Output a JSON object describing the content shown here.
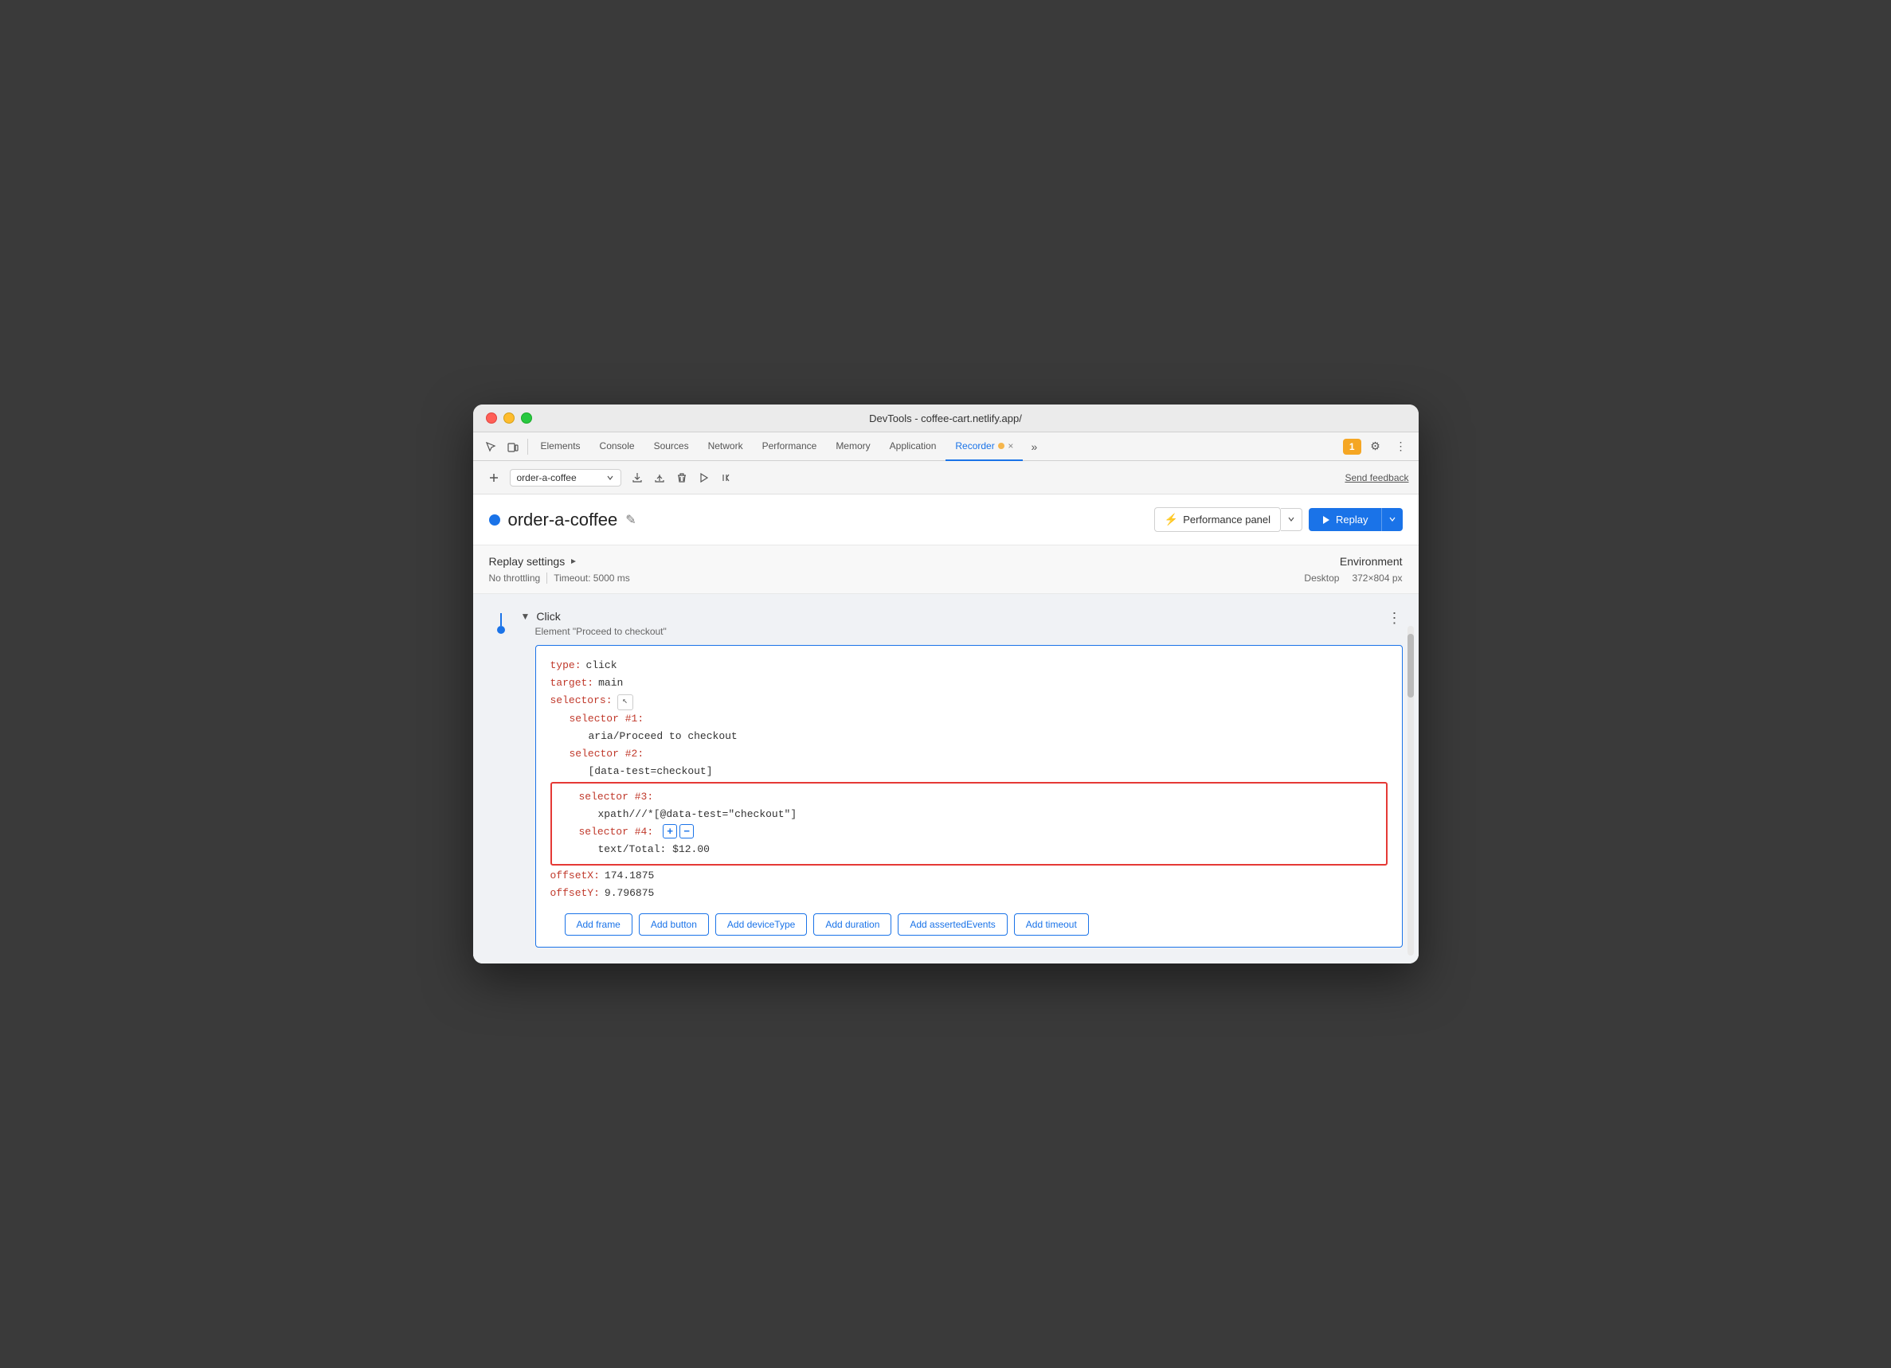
{
  "window": {
    "title": "DevTools - coffee-cart.netlify.app/"
  },
  "devtools_tabs": {
    "tabs": [
      {
        "label": "Elements",
        "active": false
      },
      {
        "label": "Console",
        "active": false
      },
      {
        "label": "Sources",
        "active": false
      },
      {
        "label": "Network",
        "active": false
      },
      {
        "label": "Performance",
        "active": false
      },
      {
        "label": "Memory",
        "active": false
      },
      {
        "label": "Application",
        "active": false
      },
      {
        "label": "Recorder",
        "active": true
      }
    ],
    "overflow_label": "»",
    "badge_count": "1"
  },
  "recorder_toolbar": {
    "recording_name": "order-a-coffee",
    "send_feedback": "Send feedback"
  },
  "recording_header": {
    "name": "order-a-coffee",
    "perf_panel_label": "Performance panel",
    "replay_label": "Replay"
  },
  "settings": {
    "title": "Replay settings",
    "throttling": "No throttling",
    "timeout": "Timeout: 5000 ms",
    "environment_title": "Environment",
    "desktop_label": "Desktop",
    "dimensions": "372×804 px"
  },
  "step": {
    "type": "Click",
    "description": "Element \"Proceed to checkout\"",
    "code": {
      "type_key": "type:",
      "type_val": "click",
      "target_key": "target:",
      "target_val": "main",
      "selectors_key": "selectors:",
      "selector1_key": "selector #1:",
      "selector1_val": "aria/Proceed to checkout",
      "selector2_key": "selector #2:",
      "selector2_val": "[data-test=checkout]",
      "selector3_key": "selector #3:",
      "selector3_val": "xpath///*[@data-test=\"checkout\"]",
      "selector4_key": "selector #4:",
      "selector4_val": "text/Total: $12.00",
      "offsetX_key": "offsetX:",
      "offsetX_val": "174.1875",
      "offsetY_key": "offsetY:",
      "offsetY_val": "9.796875"
    }
  },
  "add_buttons": [
    {
      "label": "Add frame"
    },
    {
      "label": "Add button"
    },
    {
      "label": "Add deviceType"
    },
    {
      "label": "Add duration"
    },
    {
      "label": "Add assertedEvents"
    },
    {
      "label": "Add timeout"
    }
  ]
}
